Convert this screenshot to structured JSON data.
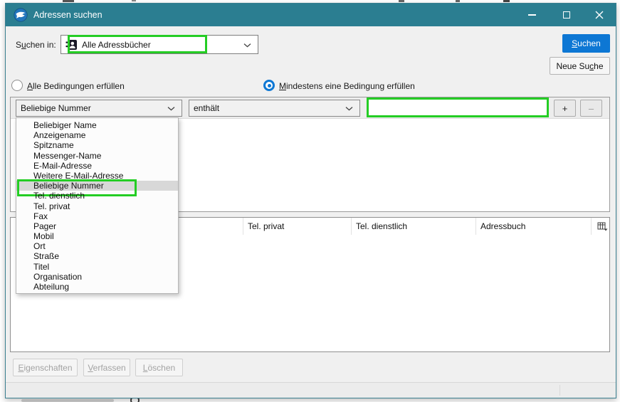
{
  "colors": {
    "titlebar_teal": "#2b7e91",
    "accent_blue": "#0d77d4",
    "annotation_green": "#24cd24"
  },
  "window": {
    "title": "Adressen suchen"
  },
  "search_in": {
    "label": {
      "pre": "S",
      "key": "u",
      "post": "chen in:"
    },
    "value": "Alle Adressbücher"
  },
  "actions": {
    "search": {
      "pre": "",
      "key": "S",
      "post": "uchen"
    },
    "new_search": {
      "pre": "Neue Su",
      "key": "c",
      "post": "he"
    }
  },
  "match": {
    "all": {
      "pre": "",
      "key": "A",
      "post": "lle Bedingungen erfüllen"
    },
    "any": {
      "pre": "",
      "key": "M",
      "post": "indestens eine Bedingung erfüllen"
    },
    "selected": "any"
  },
  "condition": {
    "field": "Beliebige Nummer",
    "operator": "enthält",
    "value": "",
    "add_label": "+",
    "remove_label": "–"
  },
  "field_menu": {
    "selected_index": 6,
    "items": [
      "Beliebiger Name",
      "Anzeigename",
      "Spitzname",
      "Messenger-Name",
      "E-Mail-Adresse",
      "Weitere E-Mail-Adresse",
      "Beliebige Nummer",
      "Tel. dienstlich",
      "Tel. privat",
      "Fax",
      "Pager",
      "Mobil",
      "Ort",
      "Straße",
      "Titel",
      "Organisation",
      "Abteilung"
    ]
  },
  "results_table": {
    "columns": [
      "",
      "Tel. privat",
      "Tel. dienstlich",
      "Adressbuch"
    ]
  },
  "footer": {
    "properties": {
      "pre": "",
      "key": "E",
      "post": "igenschaften"
    },
    "compose": {
      "pre": "",
      "key": "V",
      "post": "erfassen"
    },
    "delete": {
      "pre": "",
      "key": "L",
      "post": "öschen"
    }
  }
}
